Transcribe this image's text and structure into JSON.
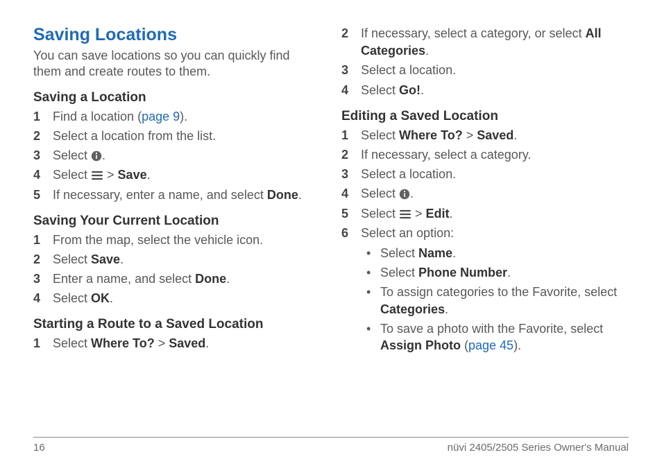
{
  "title": "Saving Locations",
  "intro": "You can save locations so you can quickly find them and create routes to them.",
  "page_ref_9": "page 9",
  "page_ref_45": "page 45",
  "icons": {
    "info": "info-icon",
    "menu": "menu-icon"
  },
  "saving_location": {
    "heading": "Saving a Location",
    "step1_a": "Find a location (",
    "step1_b": ").",
    "step2": "Select a location from the list.",
    "step3": "Select ",
    "step3_b": ".",
    "step4_a": "Select ",
    "step4_gt": " > ",
    "step4_bold": "Save",
    "step4_b": ".",
    "step5_a": "If necessary, enter a name, and select ",
    "step5_bold": "Done",
    "step5_b": "."
  },
  "current_location": {
    "heading": "Saving Your Current Location",
    "step1": "From the map, select the vehicle icon.",
    "step2_a": "Select ",
    "step2_bold": "Save",
    "step2_b": ".",
    "step3_a": "Enter a name, and select ",
    "step3_bold": "Done",
    "step3_b": ".",
    "step4_a": "Select ",
    "step4_bold": "OK",
    "step4_b": "."
  },
  "start_route": {
    "heading": "Starting a Route to a Saved Location",
    "step1_a": "Select ",
    "step1_bold1": "Where To?",
    "step1_gt": " > ",
    "step1_bold2": "Saved",
    "step1_b": ".",
    "step2_a": "If necessary, select a category, or select ",
    "step2_bold": "All Categories",
    "step2_b": ".",
    "step3": "Select a location.",
    "step4_a": "Select ",
    "step4_bold": "Go!",
    "step4_b": "."
  },
  "edit_saved": {
    "heading": "Editing a Saved Location",
    "step1_a": "Select ",
    "step1_bold1": "Where To?",
    "step1_gt": " > ",
    "step1_bold2": "Saved",
    "step1_b": ".",
    "step2": "If necessary, select a category.",
    "step3": "Select a location.",
    "step4_a": "Select ",
    "step4_b": ".",
    "step5_a": "Select ",
    "step5_gt": " > ",
    "step5_bold": "Edit",
    "step5_b": ".",
    "step6": "Select an option:",
    "opt1_a": "Select ",
    "opt1_bold": "Name",
    "opt1_b": ".",
    "opt2_a": "Select ",
    "opt2_bold": "Phone Number",
    "opt2_b": ".",
    "opt3_a": "To assign categories to the Favorite, select ",
    "opt3_bold": "Categories",
    "opt3_b": ".",
    "opt4_a": "To save a photo with the Favorite, select ",
    "opt4_bold": "Assign Photo",
    "opt4_b": " (",
    "opt4_c": ")."
  },
  "footer": {
    "page_no": "16",
    "doc_title": "nüvi 2405/2505 Series Owner's Manual"
  }
}
